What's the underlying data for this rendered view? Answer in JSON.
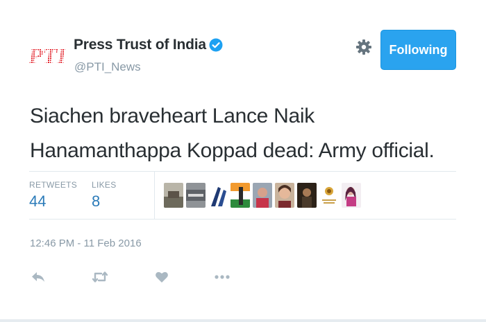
{
  "account": {
    "name": "Press Trust of India",
    "handle": "@PTI_News",
    "verified": true,
    "logo_text": "PTI",
    "follow_button_label": "Following"
  },
  "tweet": {
    "text": "Siachen braveheart Lance Naik Hanamanthappa Koppad dead: Army official.",
    "timestamp": "12:46 PM - 11 Feb 2016"
  },
  "stats": {
    "retweets_label": "RETWEETS",
    "retweets_value": "44",
    "likes_label": "LIKES",
    "likes_value": "8"
  },
  "liker_avatars": [
    {
      "name": "avatar-1"
    },
    {
      "name": "avatar-2"
    },
    {
      "name": "avatar-3"
    },
    {
      "name": "avatar-4"
    },
    {
      "name": "avatar-5"
    },
    {
      "name": "avatar-6"
    },
    {
      "name": "avatar-7"
    },
    {
      "name": "avatar-8"
    },
    {
      "name": "avatar-9"
    }
  ],
  "actions": [
    {
      "icon": "reply-icon"
    },
    {
      "icon": "retweet-icon"
    },
    {
      "icon": "heart-icon"
    },
    {
      "icon": "more-icon"
    }
  ],
  "colors": {
    "accent": "#2aa3ef",
    "link": "#2b7bb9",
    "muted": "#8899a6",
    "text": "#292f33",
    "logo_red": "#e3232c"
  }
}
